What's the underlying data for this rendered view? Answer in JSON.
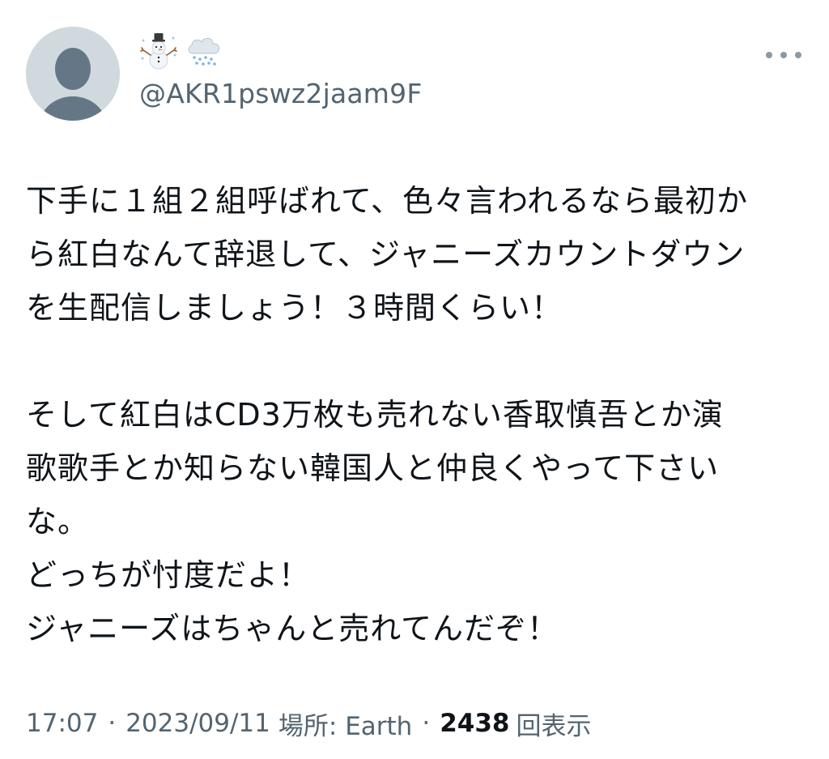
{
  "tweet": {
    "display_name_emojis": [
      "snowman-icon",
      "cloud-with-snow-icon"
    ],
    "handle": "@AKR1pswz2jaam9F",
    "body_lines": [
      "下手に１組２組呼ばれて、色々言われるなら最初か",
      "ら紅白なんて辞退して、ジャニーズカウントダウン",
      "を生配信しましょう！３時間くらい！",
      "",
      "そして紅白はCD3万枚も売れない香取慎吾とか演",
      "歌歌手とか知らない韓国人と仲良くやって下さい",
      "な。",
      "どっちが忖度だよ！",
      "ジャニーズはちゃんと売れてんだぞ！"
    ],
    "meta": {
      "time": "17:07",
      "date": "2023/09/11",
      "location_label": "場所: Earth",
      "views_count": "2438",
      "views_label": "回表示",
      "separator": "·"
    }
  },
  "colors": {
    "primary_text": "#0f1419",
    "secondary_text": "#536471",
    "avatar_bg": "#cfd9de",
    "avatar_fg": "#657786"
  }
}
